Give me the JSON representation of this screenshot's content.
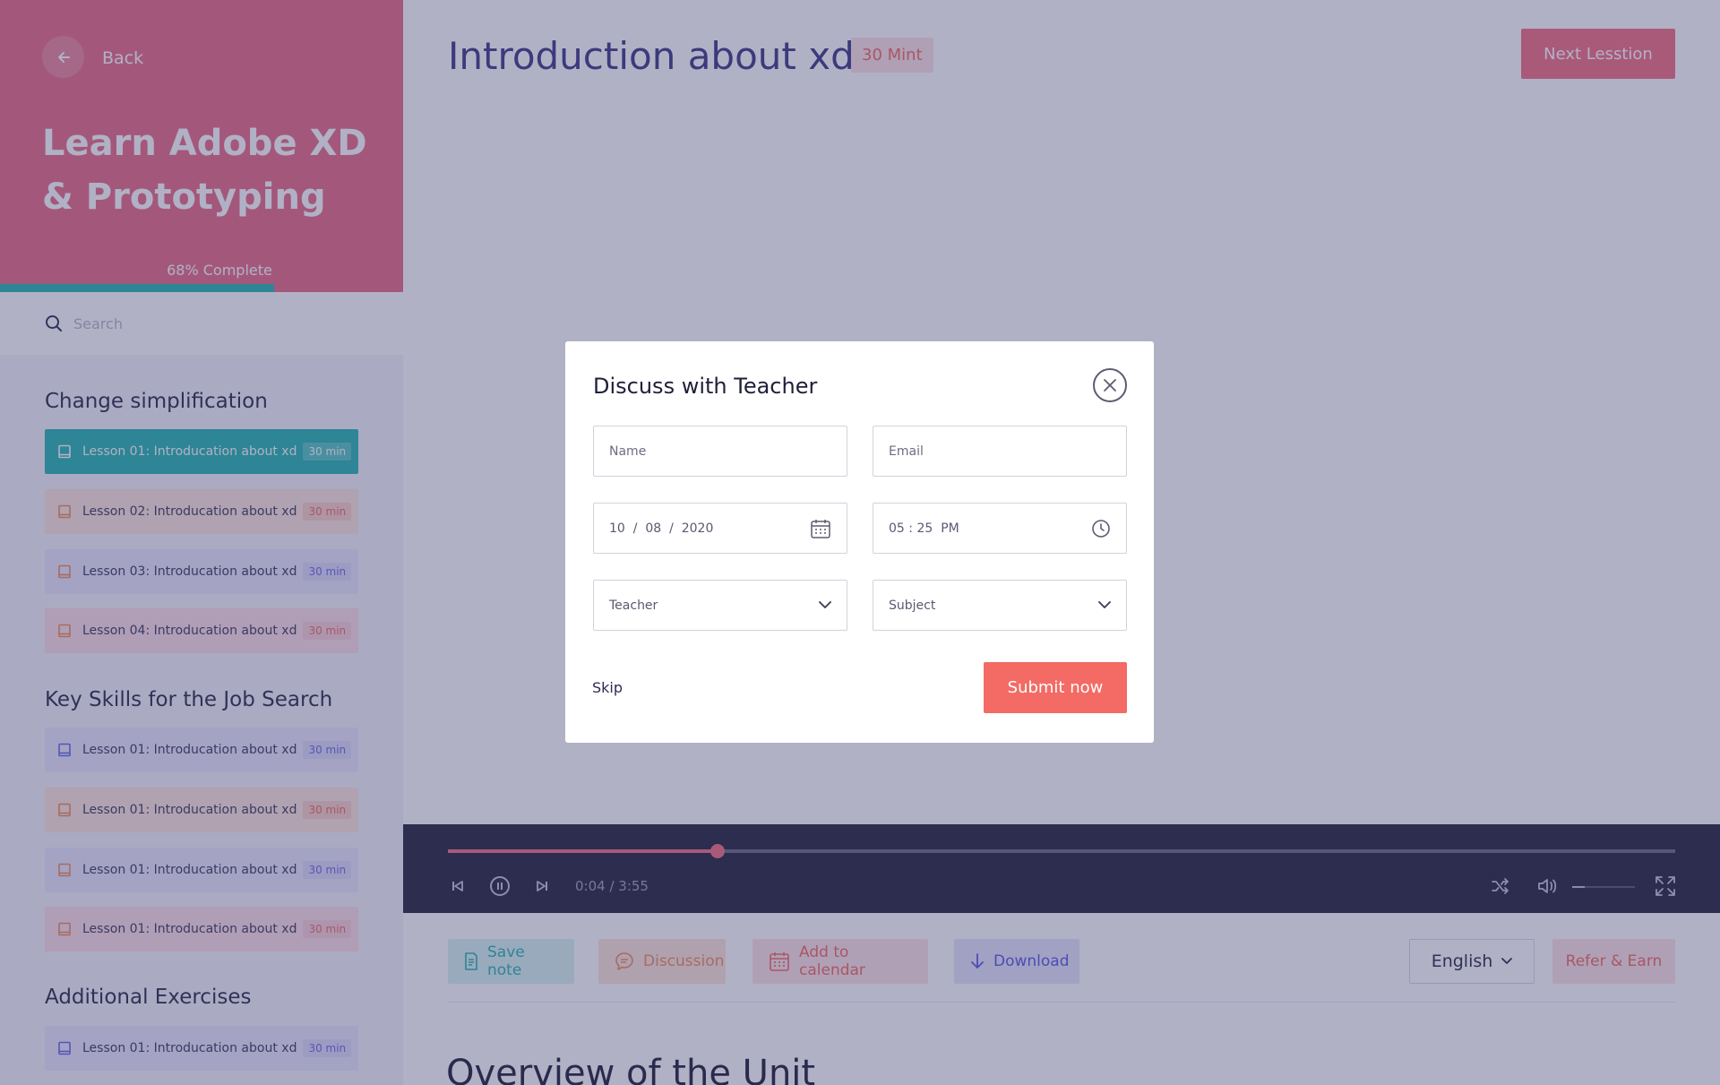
{
  "sidebar": {
    "back_label": "Back",
    "course_title": "Learn Adobe XD & Prototyping",
    "progress_label": "68% Complete",
    "progress": 0.68,
    "search_placeholder": "Search",
    "sections": [
      {
        "title": "Change simplification",
        "lessons": [
          {
            "label": "Lesson 01: Introducation about xd",
            "duration": "30 min",
            "variant": "teal"
          },
          {
            "label": "Lesson 02: Introducation about xd",
            "duration": "30 min",
            "variant": "orange"
          },
          {
            "label": "Lesson 03: Introducation about xd",
            "duration": "30 min",
            "variant": "purple"
          },
          {
            "label": "Lesson 04: Introducation about xd",
            "duration": "30 min",
            "variant": "pink"
          }
        ]
      },
      {
        "title": "Key Skills for the Job Search",
        "lessons": [
          {
            "label": "Lesson 01: Introducation about xd",
            "duration": "30 min",
            "variant": "purple"
          },
          {
            "label": "Lesson 01: Introducation about xd",
            "duration": "30 min",
            "variant": "orange"
          },
          {
            "label": "Lesson 01: Introducation about xd",
            "duration": "30 min",
            "variant": "purple"
          },
          {
            "label": "Lesson 01: Introducation about xd",
            "duration": "30 min",
            "variant": "pink"
          }
        ]
      },
      {
        "title": "Additional Exercises",
        "lessons": [
          {
            "label": "Lesson 01: Introducation about xd",
            "duration": "30 min",
            "variant": "purple"
          }
        ]
      }
    ]
  },
  "main": {
    "title": "Introduction about xd",
    "duration_badge": "30 Mint",
    "next_button": "Next Lesstion",
    "player": {
      "time": "0:04 / 3:55",
      "seek_progress": 0.22,
      "volume": 0.2
    },
    "actions": {
      "save_note": "Save note",
      "discussion": "Discussion",
      "add_to_calendar": "Add to calendar",
      "download": "Download",
      "language": "English",
      "refer": "Refer & Earn"
    },
    "overview_title": "Overview of the Unit"
  },
  "modal": {
    "title": "Discuss with Teacher",
    "name_placeholder": "Name",
    "email_placeholder": "Email",
    "date": {
      "day": "10",
      "month": "08",
      "year": "2020"
    },
    "time": {
      "hour": "05",
      "minute": "25",
      "period": "PM"
    },
    "teacher_select": "Teacher",
    "subject_select": "Subject",
    "skip_label": "Skip",
    "submit_label": "Submit now"
  },
  "colors": {
    "accent": "#f36b64",
    "hero": "#e86b84",
    "teal": "#24b6b0",
    "title_purple": "#3c3a87",
    "player_bg": "#22233b"
  },
  "icons": [
    "arrow-left-icon",
    "search-icon",
    "book-icon",
    "previous-icon",
    "pause-icon",
    "next-icon",
    "shuffle-icon",
    "volume-icon",
    "fullscreen-icon",
    "note-icon",
    "chat-icon",
    "calendar-icon",
    "download-icon",
    "chevron-down-icon",
    "close-icon",
    "clock-icon"
  ]
}
